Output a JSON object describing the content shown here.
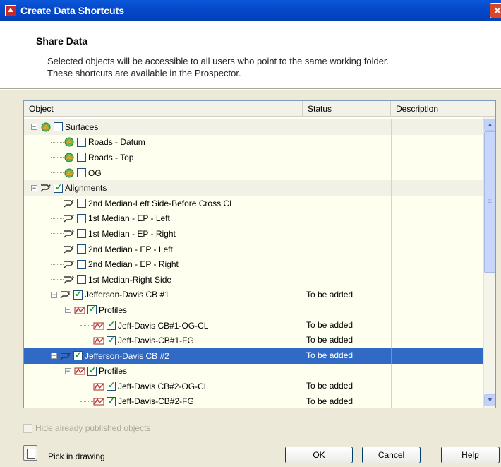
{
  "window": {
    "title": "Create Data Shortcuts",
    "close_glyph": "✕"
  },
  "header": {
    "title": "Share Data",
    "description_line1": "Selected objects will be accessible to all users who point to the same working folder.",
    "description_line2": "These shortcuts are available in the Prospector."
  },
  "columns": {
    "object": "Object",
    "status": "Status",
    "description": "Description"
  },
  "rows": [
    {
      "label": "Surfaces",
      "status": "",
      "depth": 0,
      "expander": "−",
      "icon": "surface-icon",
      "checked": false,
      "group": true
    },
    {
      "label": "Roads - Datum",
      "status": "",
      "depth": 1,
      "icon": "surface-icon",
      "checked": false
    },
    {
      "label": "Roads - Top",
      "status": "",
      "depth": 1,
      "icon": "surface-icon",
      "checked": false
    },
    {
      "label": "OG",
      "status": "",
      "depth": 1,
      "icon": "surface-icon",
      "checked": false
    },
    {
      "label": "Alignments",
      "status": "",
      "depth": 0,
      "expander": "−",
      "icon": "alignment-icon",
      "checked": true,
      "group": true
    },
    {
      "label": "2nd Median-Left Side-Before Cross CL",
      "status": "",
      "depth": 1,
      "icon": "alignment-icon",
      "checked": false
    },
    {
      "label": "1st Median - EP - Left",
      "status": "",
      "depth": 1,
      "icon": "alignment-icon",
      "checked": false
    },
    {
      "label": "1st Median - EP - Right",
      "status": "",
      "depth": 1,
      "icon": "alignment-icon",
      "checked": false
    },
    {
      "label": "2nd Median - EP - Left",
      "status": "",
      "depth": 1,
      "icon": "alignment-icon",
      "checked": false
    },
    {
      "label": "2nd Median - EP - Right",
      "status": "",
      "depth": 1,
      "icon": "alignment-icon",
      "checked": false
    },
    {
      "label": "1st Median-Right Side",
      "status": "",
      "depth": 1,
      "icon": "alignment-icon",
      "checked": false
    },
    {
      "label": "Jefferson-Davis CB #1",
      "status": "To be added",
      "depth": 1,
      "expander": "−",
      "icon": "alignment-icon",
      "checked": true
    },
    {
      "label": "Profiles",
      "status": "",
      "depth": 2,
      "expander": "−",
      "icon": "profile-icon",
      "checked": true
    },
    {
      "label": "Jeff-Davis CB#1-OG-CL",
      "status": "To be added",
      "depth": 3,
      "icon": "profile-icon",
      "checked": true
    },
    {
      "label": "Jeff-Davis-CB#1-FG",
      "status": "To be added",
      "depth": 3,
      "icon": "profile-icon",
      "checked": true
    },
    {
      "label": "Jefferson-Davis CB #2",
      "status": "To be added",
      "depth": 1,
      "expander": "−",
      "icon": "alignment-icon",
      "checked": true,
      "selected": true
    },
    {
      "label": "Profiles",
      "status": "",
      "depth": 2,
      "expander": "−",
      "icon": "profile-icon",
      "checked": true
    },
    {
      "label": "Jeff-Davis CB#2-OG-CL",
      "status": "To be added",
      "depth": 3,
      "icon": "profile-icon",
      "checked": true
    },
    {
      "label": "Jeff-Davis-CB#2-FG",
      "status": "To be added",
      "depth": 3,
      "icon": "profile-icon",
      "checked": true
    }
  ],
  "footer": {
    "hide_published_label": "Hide already published objects",
    "pick_in_drawing_label": "Pick in drawing",
    "ok_label": "OK",
    "cancel_label": "Cancel",
    "help_label": "Help"
  },
  "colors": {
    "title_bar": "#0548c9",
    "selection": "#316ac5",
    "row_background": "#fffff0"
  }
}
